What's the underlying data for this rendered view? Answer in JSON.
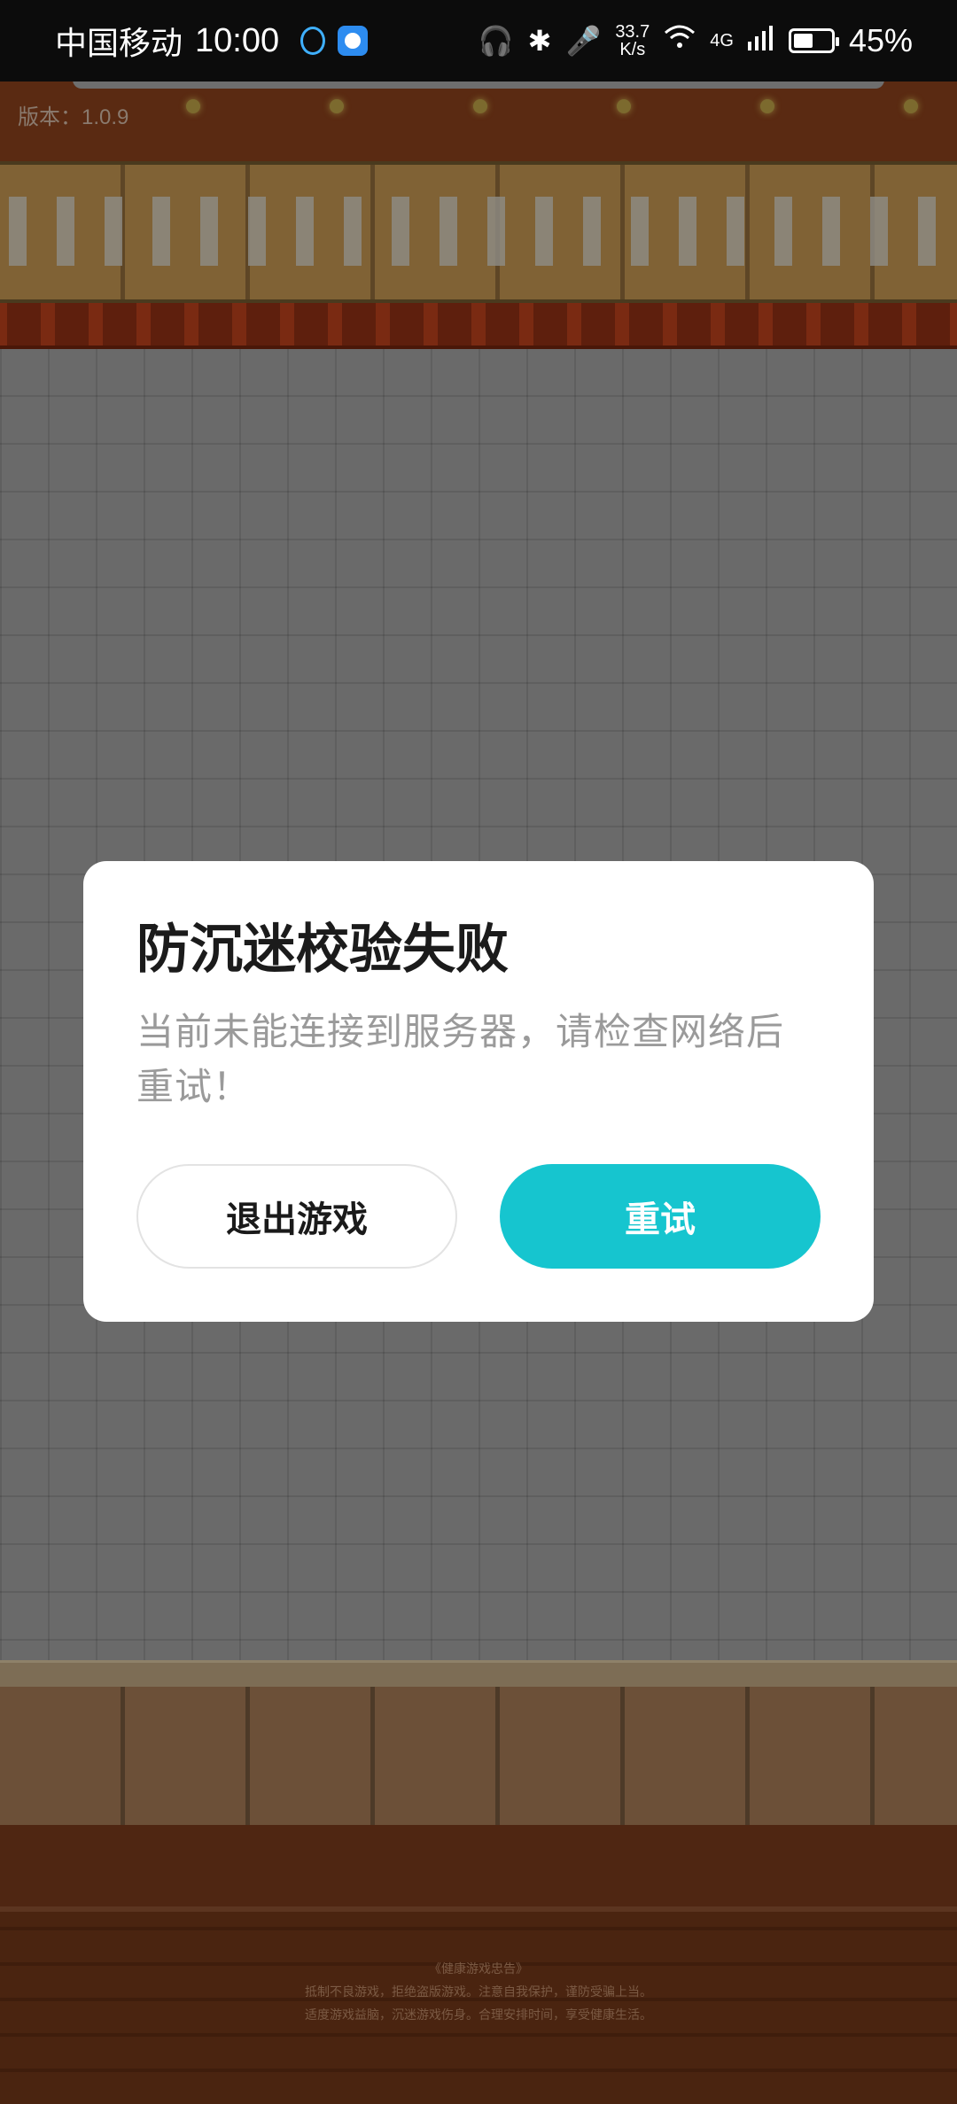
{
  "status_bar": {
    "carrier": "中国移动",
    "time": "10:00",
    "net_speed_value": "33.7",
    "net_speed_unit": "K/s",
    "network_type": "4G",
    "battery": "45%",
    "icons": [
      "headset-icon",
      "app-icon",
      "headphones-icon",
      "bluetooth-icon",
      "microphone-icon",
      "wifi-icon",
      "signal-icon",
      "battery-icon"
    ]
  },
  "game": {
    "version": "版本：1.0.9",
    "notice_lines": [
      "《健康游戏忠告》",
      "抵制不良游戏，拒绝盗版游戏。注意自我保护，谨防受骗上当。",
      "适度游戏益脑，沉迷游戏伤身。合理安排时间，享受健康生活。"
    ]
  },
  "dialog": {
    "title": "防沉迷校验失败",
    "message": "当前未能连接到服务器，请检查网络后重试！",
    "exit_button": "退出游戏",
    "retry_button": "重试"
  },
  "colors": {
    "primary": "#16c5cf",
    "dialog_bg": "#ffffff",
    "status_bar_bg": "#0c0c0c"
  }
}
